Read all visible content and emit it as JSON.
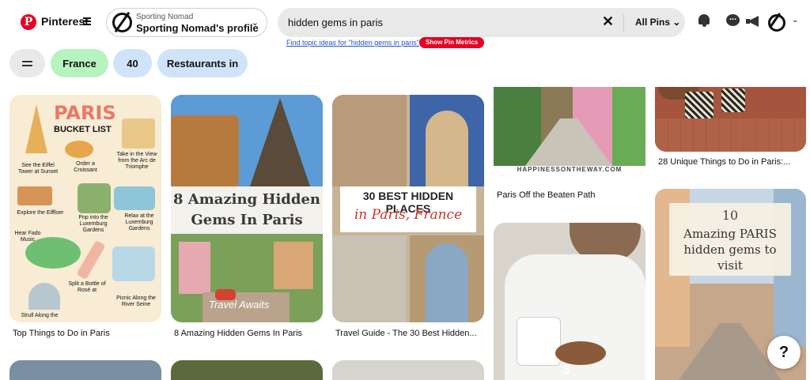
{
  "header": {
    "brand": "Pinterest",
    "logo_letter": "P",
    "profile": {
      "label_small": "Sporting Nomad",
      "label_big": "Sporting Nomad's profile"
    },
    "search": {
      "query": "hidden gems in paris",
      "scope": "All Pins"
    },
    "topic_link": "Find topic ideas for \"hidden gems in paris\"",
    "metrics_button": "Show Pin Metrics",
    "icons": [
      "bell-icon",
      "chat-icon",
      "megaphone-icon",
      "profile-avatar-icon",
      "chevron-down-icon"
    ]
  },
  "chips": [
    "France",
    "40",
    "Restaurants in"
  ],
  "pins": [
    {
      "caption": "Top Things to Do in Paris",
      "overlay": {
        "title": "PARIS",
        "subtitle": "BUCKET LIST",
        "items": [
          "See the Eiffel Tower at Sunset",
          "Order a Croissant",
          "Take in the View from the Arc de Triomphe",
          "Explore the Eiffloer",
          "Pop into the Luxemburg Gardens",
          "Relax at the Luxemburg Gardens",
          "Hear Fado Music",
          "Split a Bottle of Rosé at",
          "Picnic Along the River Seine",
          "Strull Along the"
        ]
      }
    },
    {
      "caption": "8 Amazing Hidden Gems In Paris",
      "overlay": {
        "line1": "8 Amazing Hidden",
        "line2": "Gems In Paris",
        "watermark": "Travel Awaits"
      }
    },
    {
      "caption": "Travel Guide - The 30 Best Hidden...",
      "overlay": {
        "line1": "30 BEST HIDDEN PLACES",
        "line2": "in Paris, France"
      }
    },
    {
      "caption": "Paris Off the Beaten Path",
      "overlay": {
        "footer": "HAPPINESSONTHEWAY.COM"
      }
    },
    {
      "caption": "",
      "overlay": {
        "number": "3"
      }
    },
    {
      "caption": "28 Unique Things to Do in Paris:..."
    },
    {
      "caption": "",
      "overlay": {
        "number": "10",
        "line1": "Amazing PARIS",
        "line2": "hidden gems to",
        "line3": "visit"
      }
    }
  ],
  "help_button": "?",
  "colors": {
    "brand": "#e60023",
    "chip_green": "#b6f3bf",
    "chip_blue": "#cfe4fb",
    "link": "#2253c9"
  }
}
